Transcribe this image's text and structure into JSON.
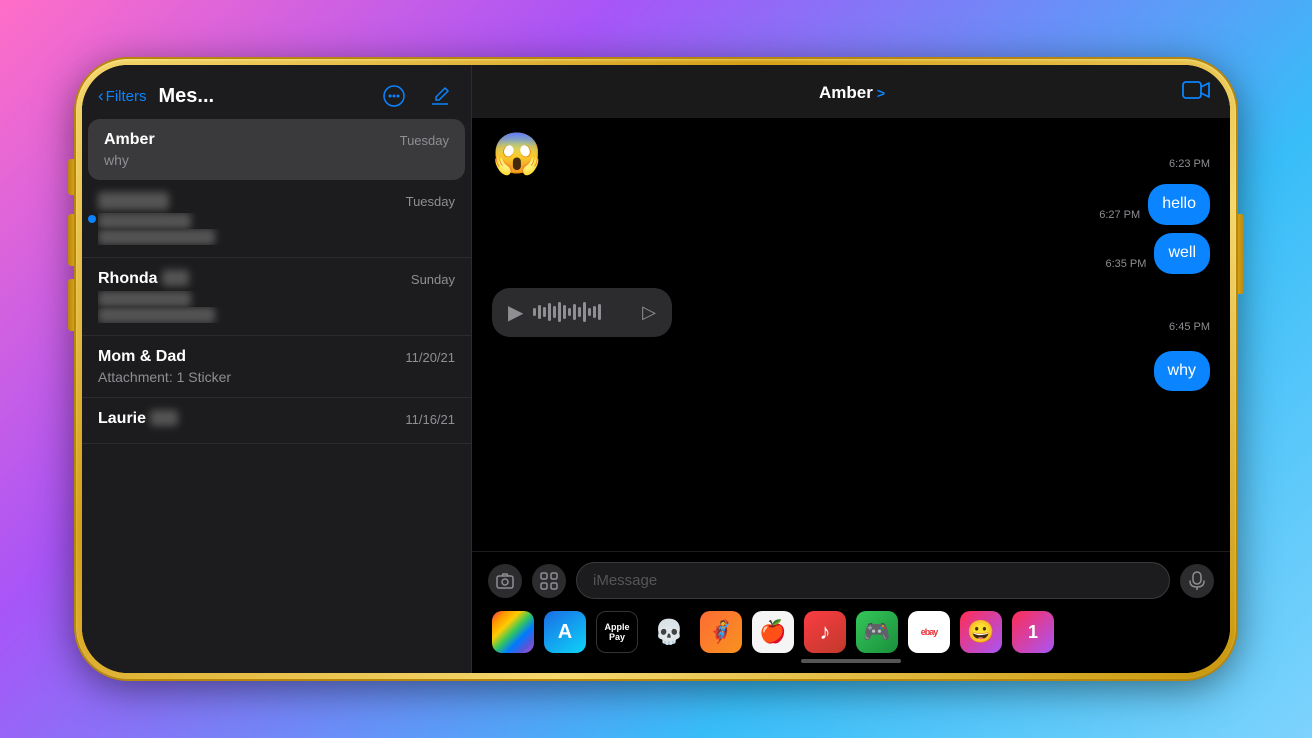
{
  "background": {
    "gradient": "pink-purple-blue"
  },
  "phone": {
    "color": "gold"
  },
  "listPanel": {
    "backLabel": "Filters",
    "title": "Mes...",
    "moreIcon": "•••",
    "composeIcon": "✏",
    "conversations": [
      {
        "id": "amber",
        "name": "Amber",
        "time": "Tuesday",
        "preview": "why",
        "selected": true,
        "blurred": false
      },
      {
        "id": "blurred1",
        "name": "",
        "time": "Tuesday",
        "preview": "",
        "selected": false,
        "blurred": true
      },
      {
        "id": "rhonda",
        "name": "Rhonda",
        "nameSuffix": "",
        "time": "Sunday",
        "preview": "",
        "selected": false,
        "blurred": true
      },
      {
        "id": "momdad",
        "name": "Mom & Dad",
        "time": "11/20/21",
        "preview": "Attachment: 1 Sticker",
        "selected": false,
        "blurred": false
      },
      {
        "id": "laurie",
        "name": "Laurie",
        "time": "11/16/21",
        "preview": "",
        "selected": false,
        "blurred": true
      }
    ]
  },
  "chatPanel": {
    "contactName": "Amber",
    "chevron": ">",
    "videoIcon": "📹",
    "messages": [
      {
        "id": "msg1",
        "type": "incoming",
        "content": "😱",
        "isEmoji": true,
        "time": "6:23 PM",
        "timeAlign": "right"
      },
      {
        "id": "msg2",
        "type": "outgoing",
        "content": "hello",
        "isEmoji": false,
        "time": "6:27 PM"
      },
      {
        "id": "msg3",
        "type": "outgoing",
        "content": "well",
        "isEmoji": false,
        "time": "6:35 PM"
      },
      {
        "id": "msg4",
        "type": "incoming",
        "content": "[audio]",
        "isAudio": true,
        "time": "6:45 PM"
      },
      {
        "id": "msg5",
        "type": "outgoing",
        "content": "why",
        "isEmoji": false,
        "time": ""
      }
    ],
    "inputPlaceholder": "iMessage",
    "appIcons": [
      {
        "id": "photos",
        "label": "🌅",
        "class": "app-icon-photos"
      },
      {
        "id": "appstore",
        "label": "A",
        "class": "app-icon-appstore"
      },
      {
        "id": "applepay",
        "label": "Apple Pay",
        "class": "app-icon-applepay"
      },
      {
        "id": "skull",
        "label": "💀",
        "class": "app-icon-skull"
      },
      {
        "id": "game1",
        "label": "🦸",
        "class": "app-icon-game1"
      },
      {
        "id": "apple",
        "label": "🍎",
        "class": "app-icon-apple"
      },
      {
        "id": "music",
        "label": "♫",
        "class": "app-icon-music"
      },
      {
        "id": "game2",
        "label": "🎮",
        "class": "app-icon-game2"
      },
      {
        "id": "ebay",
        "label": "ebay",
        "class": "app-icon-ebay"
      },
      {
        "id": "extra",
        "label": "🎭",
        "class": "app-icon-extra"
      }
    ]
  }
}
